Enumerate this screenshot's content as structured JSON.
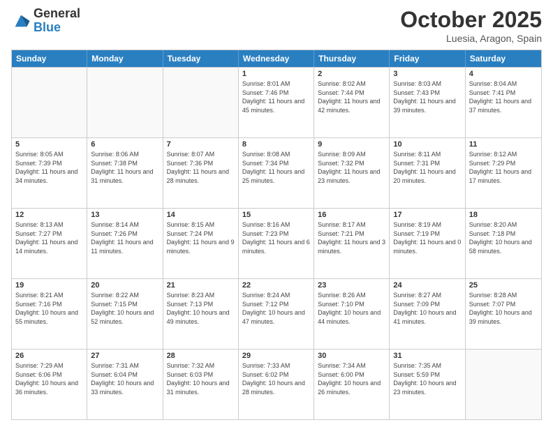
{
  "logo": {
    "general": "General",
    "blue": "Blue"
  },
  "title": "October 2025",
  "subtitle": "Luesia, Aragon, Spain",
  "headers": [
    "Sunday",
    "Monday",
    "Tuesday",
    "Wednesday",
    "Thursday",
    "Friday",
    "Saturday"
  ],
  "weeks": [
    [
      {
        "date": "",
        "info": "",
        "empty": true
      },
      {
        "date": "",
        "info": "",
        "empty": true
      },
      {
        "date": "",
        "info": "",
        "empty": true
      },
      {
        "date": "1",
        "info": "Sunrise: 8:01 AM\nSunset: 7:46 PM\nDaylight: 11 hours\nand 45 minutes.",
        "empty": false
      },
      {
        "date": "2",
        "info": "Sunrise: 8:02 AM\nSunset: 7:44 PM\nDaylight: 11 hours\nand 42 minutes.",
        "empty": false
      },
      {
        "date": "3",
        "info": "Sunrise: 8:03 AM\nSunset: 7:43 PM\nDaylight: 11 hours\nand 39 minutes.",
        "empty": false
      },
      {
        "date": "4",
        "info": "Sunrise: 8:04 AM\nSunset: 7:41 PM\nDaylight: 11 hours\nand 37 minutes.",
        "empty": false
      }
    ],
    [
      {
        "date": "5",
        "info": "Sunrise: 8:05 AM\nSunset: 7:39 PM\nDaylight: 11 hours\nand 34 minutes.",
        "empty": false
      },
      {
        "date": "6",
        "info": "Sunrise: 8:06 AM\nSunset: 7:38 PM\nDaylight: 11 hours\nand 31 minutes.",
        "empty": false
      },
      {
        "date": "7",
        "info": "Sunrise: 8:07 AM\nSunset: 7:36 PM\nDaylight: 11 hours\nand 28 minutes.",
        "empty": false
      },
      {
        "date": "8",
        "info": "Sunrise: 8:08 AM\nSunset: 7:34 PM\nDaylight: 11 hours\nand 25 minutes.",
        "empty": false
      },
      {
        "date": "9",
        "info": "Sunrise: 8:09 AM\nSunset: 7:32 PM\nDaylight: 11 hours\nand 23 minutes.",
        "empty": false
      },
      {
        "date": "10",
        "info": "Sunrise: 8:11 AM\nSunset: 7:31 PM\nDaylight: 11 hours\nand 20 minutes.",
        "empty": false
      },
      {
        "date": "11",
        "info": "Sunrise: 8:12 AM\nSunset: 7:29 PM\nDaylight: 11 hours\nand 17 minutes.",
        "empty": false
      }
    ],
    [
      {
        "date": "12",
        "info": "Sunrise: 8:13 AM\nSunset: 7:27 PM\nDaylight: 11 hours\nand 14 minutes.",
        "empty": false
      },
      {
        "date": "13",
        "info": "Sunrise: 8:14 AM\nSunset: 7:26 PM\nDaylight: 11 hours\nand 11 minutes.",
        "empty": false
      },
      {
        "date": "14",
        "info": "Sunrise: 8:15 AM\nSunset: 7:24 PM\nDaylight: 11 hours\nand 9 minutes.",
        "empty": false
      },
      {
        "date": "15",
        "info": "Sunrise: 8:16 AM\nSunset: 7:23 PM\nDaylight: 11 hours\nand 6 minutes.",
        "empty": false
      },
      {
        "date": "16",
        "info": "Sunrise: 8:17 AM\nSunset: 7:21 PM\nDaylight: 11 hours\nand 3 minutes.",
        "empty": false
      },
      {
        "date": "17",
        "info": "Sunrise: 8:19 AM\nSunset: 7:19 PM\nDaylight: 11 hours\nand 0 minutes.",
        "empty": false
      },
      {
        "date": "18",
        "info": "Sunrise: 8:20 AM\nSunset: 7:18 PM\nDaylight: 10 hours\nand 58 minutes.",
        "empty": false
      }
    ],
    [
      {
        "date": "19",
        "info": "Sunrise: 8:21 AM\nSunset: 7:16 PM\nDaylight: 10 hours\nand 55 minutes.",
        "empty": false
      },
      {
        "date": "20",
        "info": "Sunrise: 8:22 AM\nSunset: 7:15 PM\nDaylight: 10 hours\nand 52 minutes.",
        "empty": false
      },
      {
        "date": "21",
        "info": "Sunrise: 8:23 AM\nSunset: 7:13 PM\nDaylight: 10 hours\nand 49 minutes.",
        "empty": false
      },
      {
        "date": "22",
        "info": "Sunrise: 8:24 AM\nSunset: 7:12 PM\nDaylight: 10 hours\nand 47 minutes.",
        "empty": false
      },
      {
        "date": "23",
        "info": "Sunrise: 8:26 AM\nSunset: 7:10 PM\nDaylight: 10 hours\nand 44 minutes.",
        "empty": false
      },
      {
        "date": "24",
        "info": "Sunrise: 8:27 AM\nSunset: 7:09 PM\nDaylight: 10 hours\nand 41 minutes.",
        "empty": false
      },
      {
        "date": "25",
        "info": "Sunrise: 8:28 AM\nSunset: 7:07 PM\nDaylight: 10 hours\nand 39 minutes.",
        "empty": false
      }
    ],
    [
      {
        "date": "26",
        "info": "Sunrise: 7:29 AM\nSunset: 6:06 PM\nDaylight: 10 hours\nand 36 minutes.",
        "empty": false
      },
      {
        "date": "27",
        "info": "Sunrise: 7:31 AM\nSunset: 6:04 PM\nDaylight: 10 hours\nand 33 minutes.",
        "empty": false
      },
      {
        "date": "28",
        "info": "Sunrise: 7:32 AM\nSunset: 6:03 PM\nDaylight: 10 hours\nand 31 minutes.",
        "empty": false
      },
      {
        "date": "29",
        "info": "Sunrise: 7:33 AM\nSunset: 6:02 PM\nDaylight: 10 hours\nand 28 minutes.",
        "empty": false
      },
      {
        "date": "30",
        "info": "Sunrise: 7:34 AM\nSunset: 6:00 PM\nDaylight: 10 hours\nand 26 minutes.",
        "empty": false
      },
      {
        "date": "31",
        "info": "Sunrise: 7:35 AM\nSunset: 5:59 PM\nDaylight: 10 hours\nand 23 minutes.",
        "empty": false
      },
      {
        "date": "",
        "info": "",
        "empty": true
      }
    ]
  ]
}
